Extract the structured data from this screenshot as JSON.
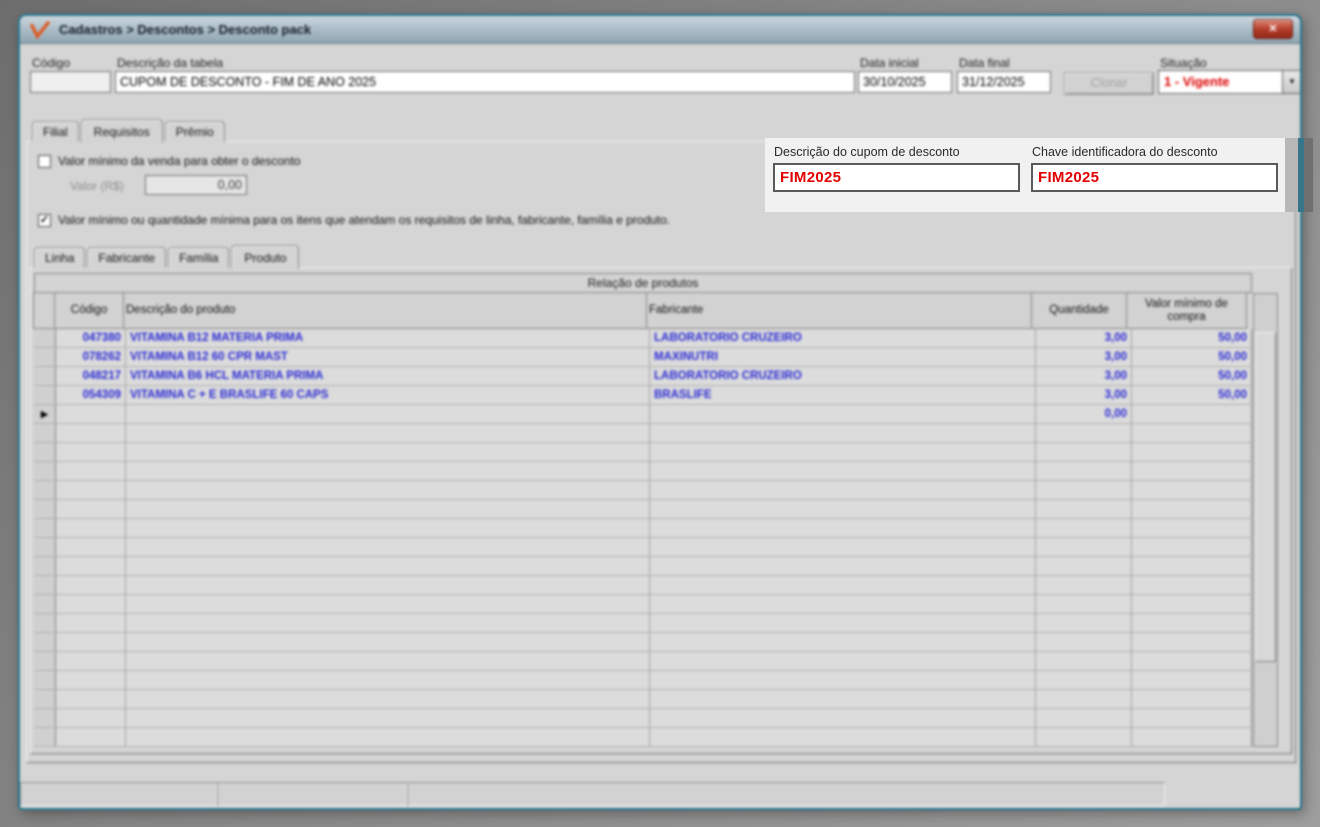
{
  "window": {
    "title": "Cadastros > Descontos > Desconto pack"
  },
  "icons": {
    "close": "✕",
    "dropdown": "▼",
    "row_marker": "▶",
    "check": "✓",
    "logo": "orange-check"
  },
  "colors": {
    "window_border": "#37758a",
    "titlebar": "#aebfca",
    "situacao_red": "#dd0000",
    "grid_text_blue": "#2a2ad4",
    "highlight_bg": "#f1f1f1",
    "coupon_text_red": "#e30000"
  },
  "form": {
    "codigo": {
      "label": "Código",
      "value": ""
    },
    "descricao_tabela": {
      "label": "Descrição da tabela",
      "value": "CUPOM DE DESCONTO - FIM DE ANO 2025"
    },
    "data_inicial": {
      "label": "Data inicial",
      "value": "30/10/2025"
    },
    "data_final": {
      "label": "Data final",
      "value": "31/12/2025"
    },
    "clonar_button": "Clonar",
    "situacao": {
      "label": "Situação",
      "value": "1 - Vigente"
    }
  },
  "tabs": {
    "items": [
      "Filial",
      "Requisitos",
      "Prêmio"
    ],
    "active": "Requisitos"
  },
  "requisitos": {
    "min_venda_checkbox": {
      "checked": false,
      "label": "Valor mínimo da venda para obter o desconto"
    },
    "valor": {
      "label": "Valor (R$)",
      "value": "0,00"
    },
    "cupom": {
      "descricao": {
        "label": "Descrição do cupom de desconto",
        "value": "FIM2025"
      },
      "chave": {
        "label": "Chave identificadora do desconto",
        "value": "FIM2025"
      }
    },
    "min_itens_checkbox": {
      "checked": true,
      "label": "Valor mínimo ou quantidade mínima para os itens que atendam os requisitos de linha, fabricante, família e produto."
    },
    "subtabs": {
      "items": [
        "Linha",
        "Fabricante",
        "Família",
        "Produto"
      ],
      "active": "Produto"
    }
  },
  "grid": {
    "title": "Relação de produtos",
    "columns": {
      "codigo": "Código",
      "descricao": "Descrição do produto",
      "fabricante": "Fabricante",
      "quantidade": "Quantidade",
      "valor_minimo": "Valor mínimo de compra"
    },
    "rows": [
      {
        "codigo": "047380",
        "descricao": "VITAMINA B12  MATERIA PRIMA",
        "fabricante": "LABORATORIO CRUZEIRO",
        "quantidade": "3,00",
        "valor_minimo": "50,00"
      },
      {
        "codigo": "078262",
        "descricao": "VITAMINA B12 60 CPR MAST",
        "fabricante": "MAXINUTRI",
        "quantidade": "3,00",
        "valor_minimo": "50,00"
      },
      {
        "codigo": "048217",
        "descricao": "VITAMINA B6 HCL  MATERIA PRIMA",
        "fabricante": "LABORATORIO CRUZEIRO",
        "quantidade": "3,00",
        "valor_minimo": "50,00"
      },
      {
        "codigo": "054309",
        "descricao": "VITAMINA C + E BRASLIFE 60 CAPS",
        "fabricante": "BRASLIFE",
        "quantidade": "3,00",
        "valor_minimo": "50,00"
      }
    ],
    "new_row": {
      "quantidade": "0,00"
    },
    "empty_row_count": 17
  }
}
